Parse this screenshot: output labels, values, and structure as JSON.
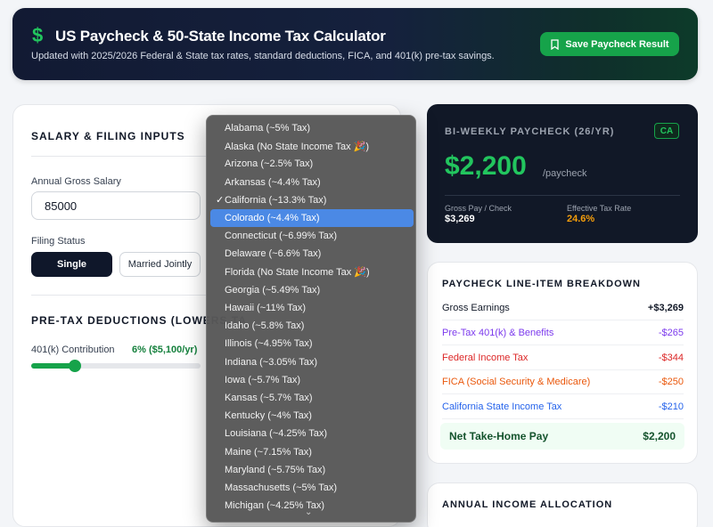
{
  "header": {
    "icon": "dollar-icon",
    "title": "US Paycheck & 50-State Income Tax Calculator",
    "subtitle": "Updated with 2025/2026 Federal & State tax rates, standard deductions, FICA, and 401(k) pre-tax savings.",
    "save_label": "Save Paycheck Result"
  },
  "inputs": {
    "section_title": "SALARY & FILING INPUTS",
    "salary_label": "Annual Gross Salary",
    "salary_value": "85000",
    "filing_label": "Filing Status",
    "filing_options": [
      "Single",
      "Married Jointly"
    ],
    "filing_selected": "Single",
    "pretax_title": "PRE-TAX DEDUCTIONS (LOWERS TA",
    "k401_label": "401(k) Contribution",
    "k401_value": "6% ($5,100/yr)",
    "k401_fraction": 0.26
  },
  "state_dropdown": {
    "options": [
      "Alabama (~5% Tax)",
      "Alaska (No State Income Tax 🎉)",
      "Arizona (~2.5% Tax)",
      "Arkansas (~4.4% Tax)",
      "California (~13.3% Tax)",
      "Colorado (~4.4% Tax)",
      "Connecticut (~6.99% Tax)",
      "Delaware (~6.6% Tax)",
      "Florida (No State Income Tax 🎉)",
      "Georgia (~5.49% Tax)",
      "Hawaii (~11% Tax)",
      "Idaho (~5.8% Tax)",
      "Illinois (~4.95% Tax)",
      "Indiana (~3.05% Tax)",
      "Iowa (~5.7% Tax)",
      "Kansas (~5.7% Tax)",
      "Kentucky (~4% Tax)",
      "Louisiana (~4.25% Tax)",
      "Maine (~7.15% Tax)",
      "Maryland (~5.75% Tax)",
      "Massachusetts (~5% Tax)",
      "Michigan (~4.25% Tax)"
    ],
    "checked_index": 4,
    "highlighted_index": 5,
    "check_mark": "✓",
    "more_arrow": "⌄"
  },
  "paycheck": {
    "label": "BI-WEEKLY PAYCHECK (26/YR)",
    "state_badge": "CA",
    "amount": "$2,200",
    "per": "/paycheck",
    "gross_label": "Gross Pay / Check",
    "gross_value": "$3,269",
    "rate_label": "Effective Tax Rate",
    "rate_value": "24.6%",
    "colors": {
      "amount": "#22c55e",
      "rate": "#f59e0b"
    }
  },
  "breakdown": {
    "title": "PAYCHECK LINE-ITEM BREAKDOWN",
    "rows": [
      {
        "label": "Gross Earnings",
        "value": "+$3,269",
        "color": "#111827"
      },
      {
        "label": "Pre-Tax 401(k) & Benefits",
        "value": "-$265",
        "color": "#7c3aed"
      },
      {
        "label": "Federal Income Tax",
        "value": "-$344",
        "color": "#dc2626"
      },
      {
        "label": "FICA (Social Security & Medicare)",
        "value": "-$250",
        "color": "#ea580c"
      },
      {
        "label": "California State Income Tax",
        "value": "-$210",
        "color": "#2563eb"
      }
    ],
    "net_label": "Net Take-Home Pay",
    "net_value": "$2,200"
  },
  "allocation": {
    "title": "ANNUAL INCOME ALLOCATION"
  }
}
